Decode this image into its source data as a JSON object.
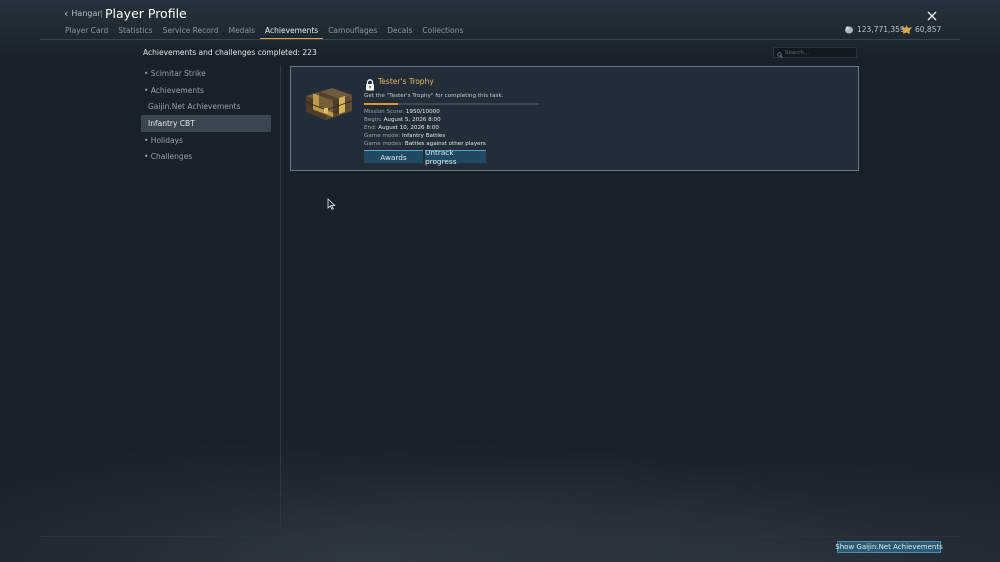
{
  "header": {
    "back_label": "Hangar",
    "separator": "|",
    "title": "Player Profile",
    "close_icon": "close-icon"
  },
  "tabs": [
    {
      "label": "Player Card",
      "active": false
    },
    {
      "label": "Statistics",
      "active": false
    },
    {
      "label": "Service Record",
      "active": false
    },
    {
      "label": "Medals",
      "active": false
    },
    {
      "label": "Achievements",
      "active": true
    },
    {
      "label": "Camouflages",
      "active": false
    },
    {
      "label": "Decals",
      "active": false
    },
    {
      "label": "Collections",
      "active": false
    }
  ],
  "currency": {
    "silver_lions": "123,771,359",
    "golden_eagles": "60,857"
  },
  "summary_text": "Achievements and challenges completed: 223",
  "search": {
    "placeholder": "Search..."
  },
  "sidebar": {
    "items": [
      {
        "label": "• Scimitar Strike"
      },
      {
        "label": "• Achievements"
      },
      {
        "label": "Gaijin.Net Achievements"
      },
      {
        "label": "Infantry CBT"
      },
      {
        "label": "• Holidays"
      },
      {
        "label": "• Challenges"
      }
    ],
    "selected": "Infantry CBT"
  },
  "achievement": {
    "title": "Tester's Trophy",
    "description": "Get the \"Tester's Trophy\" for completing this task.",
    "progress_fraction": 0.195,
    "mission_score_label": "Mission Score:",
    "mission_score_value": "1950/10000",
    "begin_label": "Begin:",
    "begin_value": "August 5, 2026 8:00",
    "end_label": "End:",
    "end_value": "August 10, 2026 8:00",
    "game_mode_label": "Game mode:",
    "game_mode_value": "Infantry Battles",
    "game_modes_label": "Game modes:",
    "game_modes_value": "Battles against other players",
    "awards_button": "Awards",
    "untrack_button": "Untrack progress"
  },
  "footer": {
    "show_button": "Show Gaijin.Net Achievements"
  },
  "colors": {
    "accent_orange": "#e0962d",
    "title_gold": "#e9b760",
    "button_blue": "#1f4a62"
  }
}
